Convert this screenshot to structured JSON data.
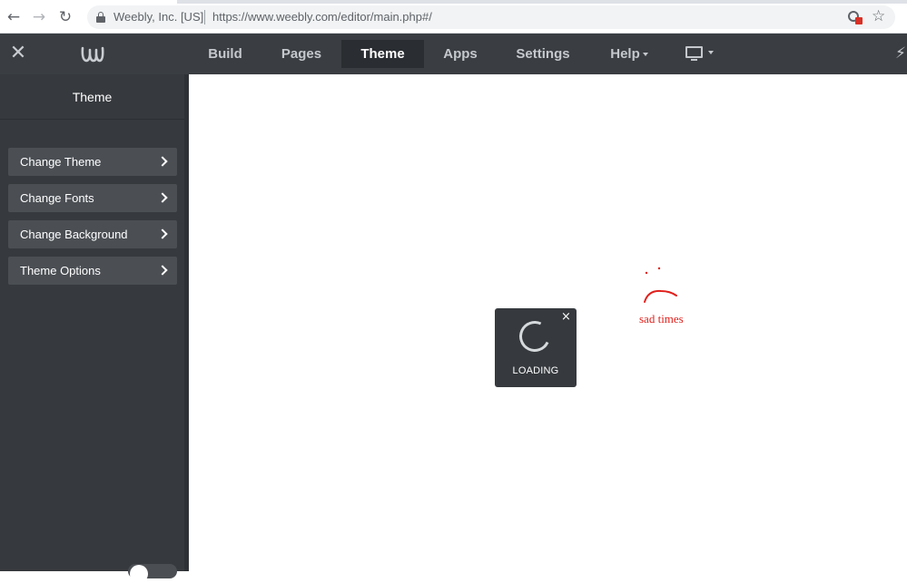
{
  "browser": {
    "back_icon": "arrow-left-icon",
    "forward_icon": "arrow-right-icon",
    "reload_icon": "reload-icon",
    "site_org": "Weebly, Inc. [US]",
    "url_host": "https://www.weebly.com",
    "url_path": "/editor/main.php#/"
  },
  "topnav": {
    "close_icon": "close-icon",
    "logo": "weebly-logo",
    "items": [
      {
        "label": "Build"
      },
      {
        "label": "Pages"
      },
      {
        "label": "Theme"
      },
      {
        "label": "Apps"
      },
      {
        "label": "Settings"
      },
      {
        "label": "Help"
      }
    ],
    "active": "Theme"
  },
  "sidebar": {
    "title": "Theme",
    "buttons": [
      {
        "label": "Change Theme"
      },
      {
        "label": "Change Fonts"
      },
      {
        "label": "Change Background"
      },
      {
        "label": "Theme Options"
      }
    ]
  },
  "loading": {
    "label": "LOADING",
    "close_glyph": "×"
  },
  "annotation": {
    "text": "sad times",
    "color": "#e0201c"
  },
  "colors": {
    "topnav_bg": "#3a3e43",
    "sidebar_bg": "#36393d",
    "button_bg": "#4b4f54"
  }
}
